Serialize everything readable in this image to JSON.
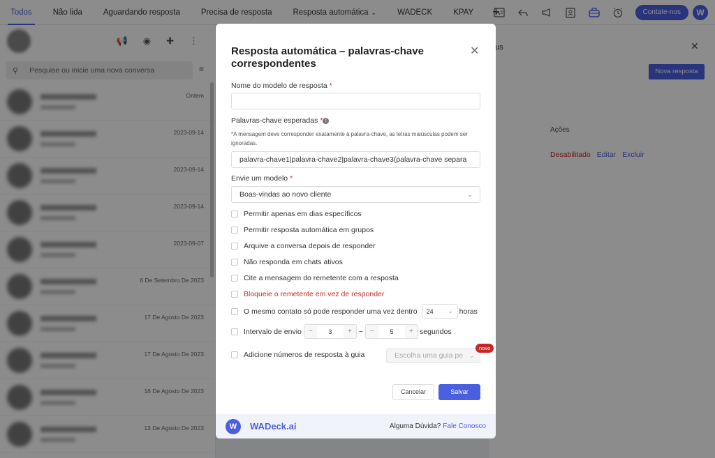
{
  "tabs": [
    {
      "label": "Todos"
    },
    {
      "label": "Não lida"
    },
    {
      "label": "Aguardando resposta"
    },
    {
      "label": "Precisa de resposta"
    },
    {
      "label": "Resposta automática"
    },
    {
      "label": "WADECK"
    },
    {
      "label": "KPAY"
    }
  ],
  "header": {
    "contact_label": "Contate-nos",
    "logo_letter": "W"
  },
  "left": {
    "search_placeholder": "Pesquise ou inicie uma nova conversa",
    "chats": [
      {
        "date": "Ontem"
      },
      {
        "date": "2023-09-14"
      },
      {
        "date": "2023-09-14"
      },
      {
        "date": "2023-09-14"
      },
      {
        "date": "2023-09-07"
      },
      {
        "date": "6 De Setembro De 2023"
      },
      {
        "date": "17 De Agosto De 2023"
      },
      {
        "date": "17 De Agosto De 2023"
      },
      {
        "date": "16 De Agosto De 2023"
      },
      {
        "date": "13 De Agosto De 2023"
      }
    ]
  },
  "right": {
    "title_partial": "atus",
    "new_button": "Nova resposta",
    "col_actions": "Ações",
    "row_status": "Desabilitado",
    "row_edit": "Editar",
    "row_delete": "Excluir"
  },
  "modal": {
    "title": "Resposta automática – palavras-chave correspondentes",
    "template_name_label": "Nome do modelo de resposta",
    "template_name_value": "",
    "keywords_label": "Palavras-chave esperadas",
    "keywords_note": "*A mensagem deve corresponder exatamente à palavra-chave, as letras maiúsculas podem ser ignoradas.",
    "keywords_placeholder": "palavra-chave1|palavra-chave2|palavra-chave3(palavra-chave separa",
    "send_model_label": "Envie um modelo",
    "send_model_value": "Boas-vindas ao novo cliente",
    "options": [
      {
        "label": "Permitir apenas em dias específicos",
        "red": false
      },
      {
        "label": "Permitir resposta automática em grupos",
        "red": false
      },
      {
        "label": "Arquive a conversa depois de responder",
        "red": false
      },
      {
        "label": "Não responda em chats ativos",
        "red": false
      },
      {
        "label": "Cite a mensagem do remetente com a resposta",
        "red": false
      },
      {
        "label": "Bloqueie o remetente em vez de responder",
        "red": true
      }
    ],
    "once_label": "O mesmo contato só pode responder uma vez dentro",
    "once_value": "24",
    "once_unit": "horas",
    "interval_label": "Intervalo de envio",
    "interval_min": "3",
    "interval_sep": "~",
    "interval_max": "5",
    "interval_unit": "segundos",
    "guide_label": "Adicione números de resposta à guia",
    "guide_placeholder": "Escolha uma guia pe",
    "new_badge": "novo",
    "cancel": "Cancelar",
    "save": "Salvar",
    "footer_brand": "WADeck.ai",
    "footer_logo": "W",
    "footer_question": "Alguma Dúvida?",
    "footer_link": "Fale Conosco"
  },
  "colors": {
    "accent": "#4a5fe0",
    "danger": "#c62828"
  }
}
